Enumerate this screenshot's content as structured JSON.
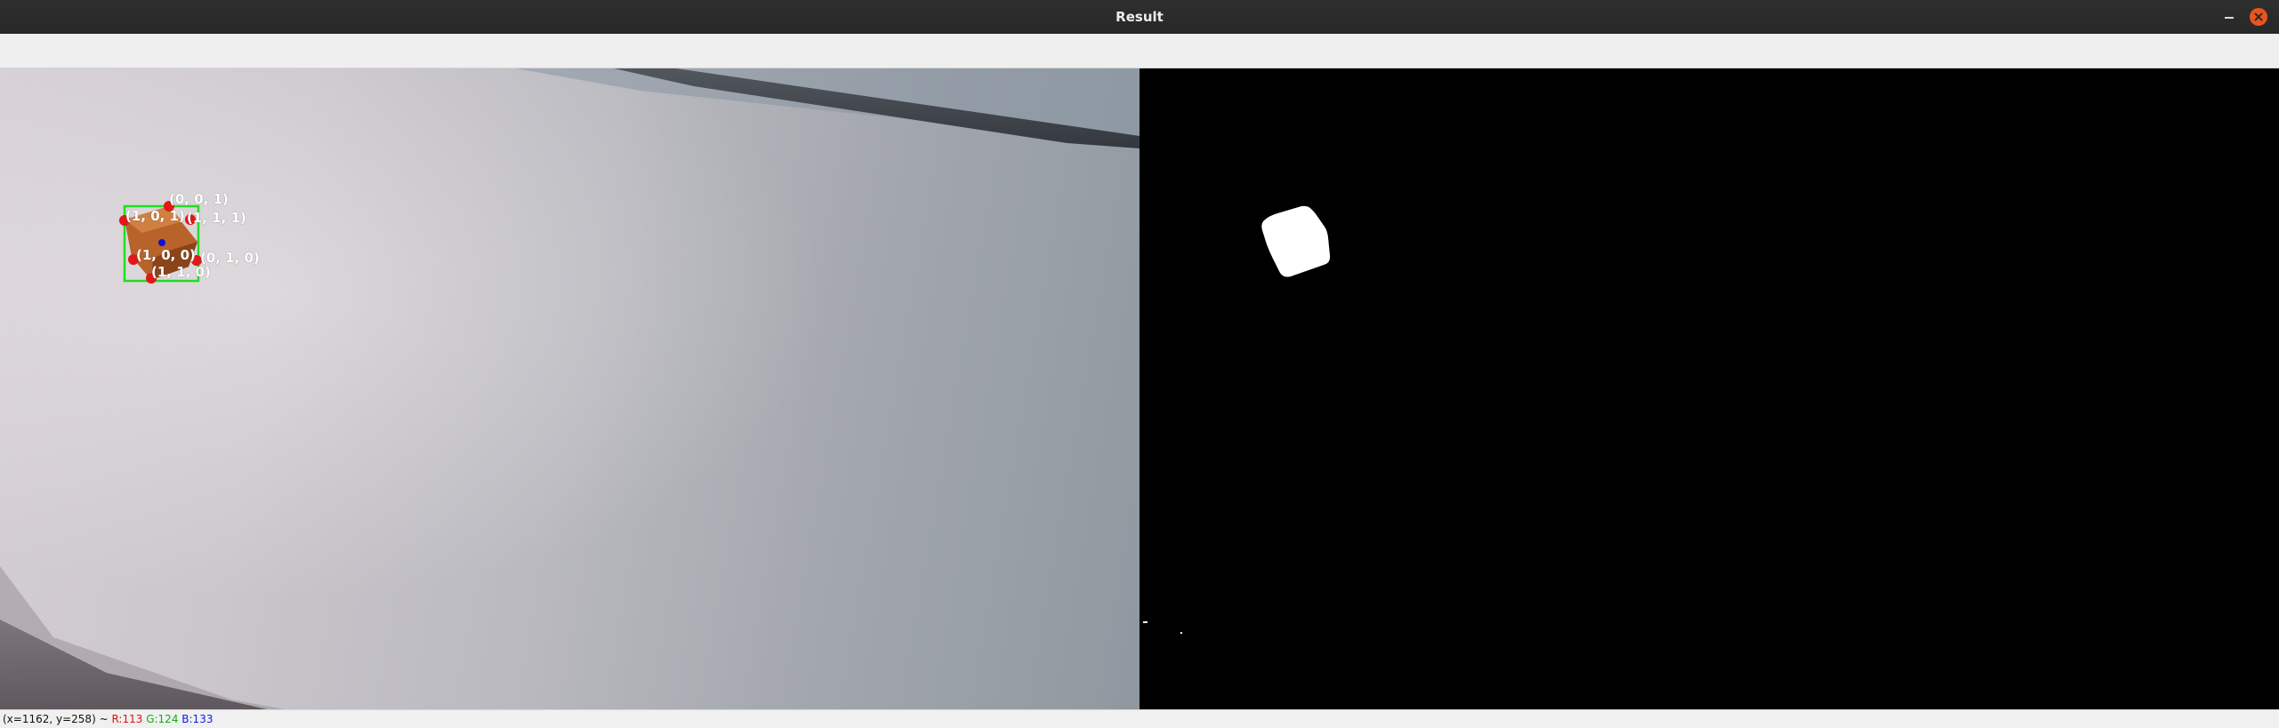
{
  "window": {
    "title": "Result"
  },
  "corner_labels": [
    {
      "text": "(0, 0, 1)"
    },
    {
      "text": "(1, 0, 1)"
    },
    {
      "text": "(1, 1, 1)"
    },
    {
      "text": "(1, 0, 0)"
    },
    {
      "text": "(0, 1, 0)"
    },
    {
      "text": "(1, 1, 0)"
    }
  ],
  "status": {
    "coords": "(x=1162, y=258) ~",
    "r": "R:113",
    "g": "G:124",
    "b": "B:133"
  },
  "colors": {
    "bbox": "#22dd22",
    "corner_point": "#e01818",
    "center_point": "#1010d0",
    "mask_blob": "#ffffff",
    "titlebar": "#2c2c2c",
    "close_button": "#e95420"
  },
  "icons": {
    "minimize": "minimize-icon",
    "close": "close-icon"
  }
}
